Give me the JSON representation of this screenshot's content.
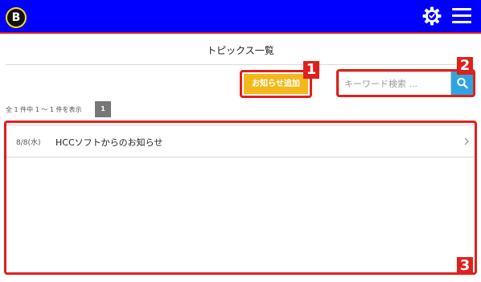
{
  "header": {
    "logo_letter": "B",
    "bar_color": "#0000ff",
    "accent_color": "#e0201c",
    "icons": [
      "settings-gear-icon",
      "hamburger-menu-icon"
    ]
  },
  "page": {
    "title": "トピックス一覧"
  },
  "toolbar": {
    "add_label": "お知らせ追加",
    "add_color": "#f2b91d",
    "search_placeholder": "キーワード検索 ...",
    "search_icon": "search-icon"
  },
  "pagination": {
    "summary": "全 1 件中 1 〜 1 件を表示",
    "pages": [
      "1"
    ]
  },
  "topics": [
    {
      "date": "8/8(水)",
      "title": "HCCソフトからのお知らせ"
    }
  ],
  "callouts": [
    "1",
    "2",
    "3"
  ]
}
